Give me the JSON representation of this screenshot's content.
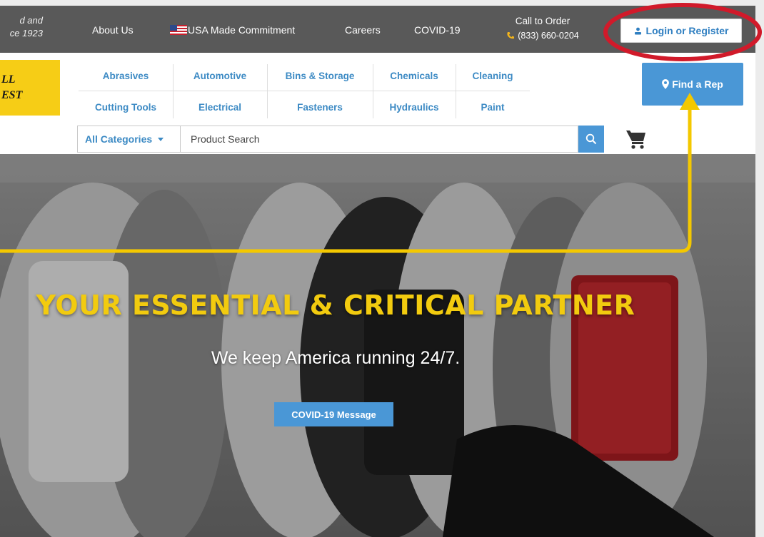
{
  "topbar": {
    "since_line1": "d and",
    "since_line2": "ce 1923",
    "links": {
      "about": "About Us",
      "usa": "USA Made Commitment",
      "careers": "Careers",
      "covid": "COVID-19"
    },
    "call_label": "Call to Order",
    "phone": "(833) 660-0204",
    "login": "Login or Register"
  },
  "logo": {
    "line1": "LL",
    "line2": "EST"
  },
  "categories": {
    "row1": [
      "Abrasives",
      "Automotive",
      "Bins & Storage",
      "Chemicals",
      "Cleaning"
    ],
    "row2": [
      "Cutting Tools",
      "Electrical",
      "Fasteners",
      "Hydraulics",
      "Paint"
    ]
  },
  "find_rep": "Find a Rep",
  "search": {
    "category": "All Categories",
    "placeholder": "Product Search"
  },
  "hero": {
    "title": "YOUR ESSENTIAL & CRITICAL PARTNER",
    "subtitle": "We keep America running 24/7.",
    "button": "COVID-19 Message"
  },
  "colors": {
    "topbar": "#595959",
    "brand_yellow": "#f6cd16",
    "link_blue": "#3c8ac4",
    "button_blue": "#4a97d6",
    "annotation_red": "#d11a2a",
    "annotation_yellow": "#f4c800"
  },
  "icons": {
    "user": "user-icon",
    "flag": "us-flag-icon",
    "phone": "phone-icon",
    "pin": "map-pin-icon",
    "caret": "caret-down-icon",
    "search": "search-icon",
    "cart": "cart-icon"
  }
}
